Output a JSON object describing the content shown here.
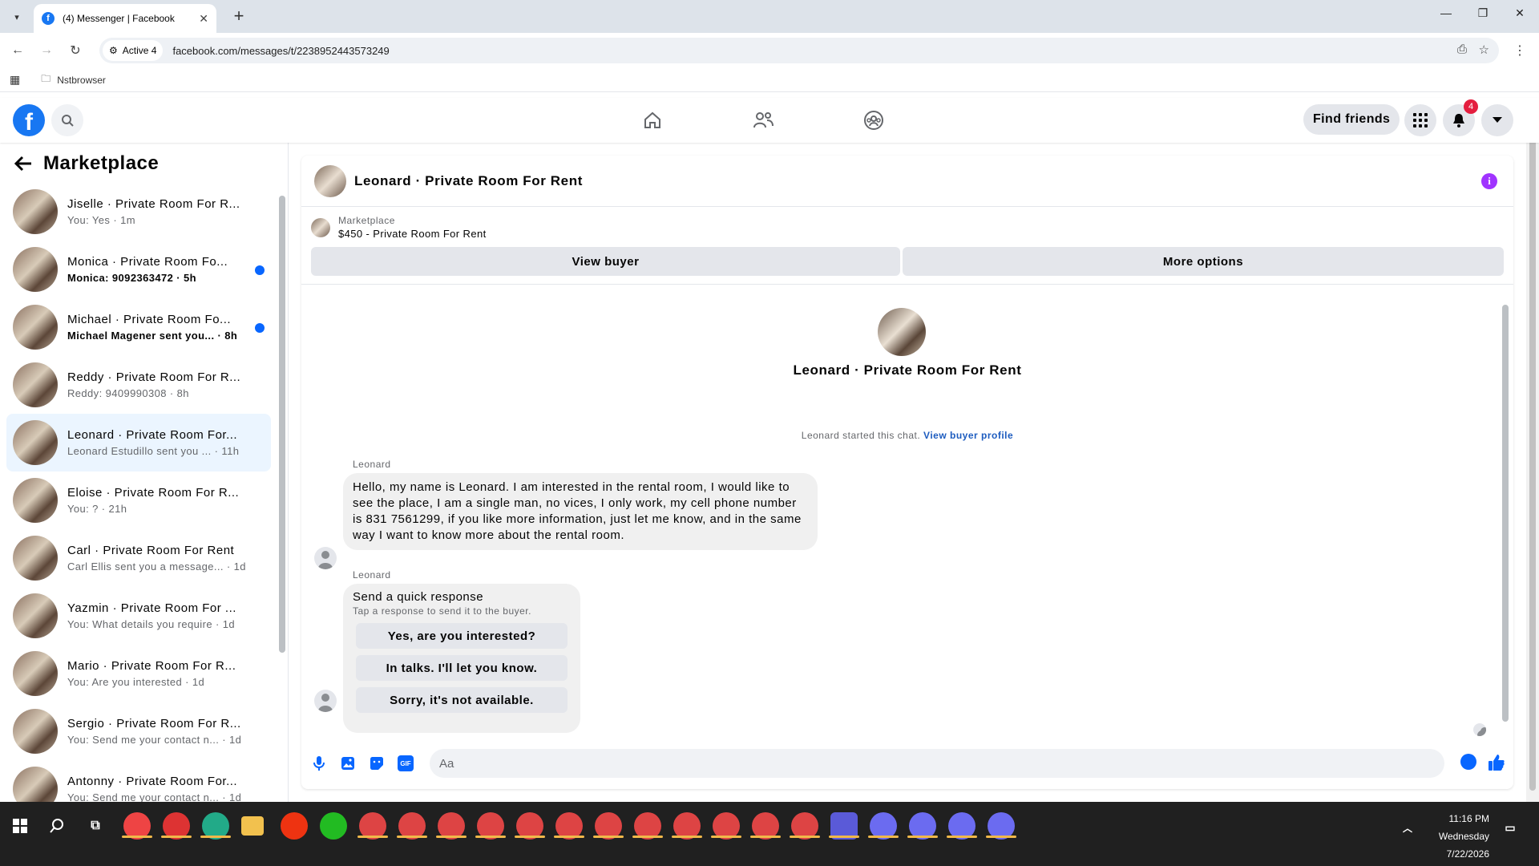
{
  "browser": {
    "tab_title": "(4) Messenger | Facebook",
    "tab_favicon": "f",
    "close_tab": "✕",
    "new_tab": "+",
    "site_info_label": "Active 4",
    "url": "facebook.com/messages/t/2238952443573249",
    "bookmark_folder": "Nstbrowser"
  },
  "fb_header": {
    "find_friends_label": "Find friends",
    "notification_count": "4"
  },
  "sidebar": {
    "title": "Marketplace",
    "conversations": [
      {
        "name": "Jiselle · Private Room For R...",
        "preview": "You: Yes · 1m",
        "unread": false,
        "active": false
      },
      {
        "name": "Monica · Private Room Fo...",
        "preview": "Monica: 9092363472 · 5h",
        "unread": true,
        "active": false
      },
      {
        "name": "Michael · Private Room Fo...",
        "preview": "Michael Magener sent you... · 8h",
        "unread": true,
        "active": false
      },
      {
        "name": "Reddy · Private Room For R...",
        "preview": "Reddy: 9409990308 · 8h",
        "unread": false,
        "active": false
      },
      {
        "name": "Leonard · Private Room For...",
        "preview": "Leonard Estudillo sent you ... · 11h",
        "unread": false,
        "active": true
      },
      {
        "name": "Eloise · Private Room For R...",
        "preview": "You: ? · 21h",
        "unread": false,
        "active": false
      },
      {
        "name": "Carl · Private Room For Rent",
        "preview": "Carl Ellis sent you a message... · 1d",
        "unread": false,
        "active": false
      },
      {
        "name": "Yazmin · Private Room For ...",
        "preview": "You: What details you require · 1d",
        "unread": false,
        "active": false
      },
      {
        "name": "Mario · Private Room For R...",
        "preview": "You: Are you interested · 1d",
        "unread": false,
        "active": false
      },
      {
        "name": "Sergio · Private Room For R...",
        "preview": "You: Send me your contact n... · 1d",
        "unread": false,
        "active": false
      },
      {
        "name": "Antonny · Private Room For...",
        "preview": "You: Send me your contact n... · 1d",
        "unread": false,
        "active": false
      }
    ]
  },
  "chat": {
    "title": "Leonard · Private Room For Rent",
    "info_glyph": "i",
    "marketplace_label": "Marketplace",
    "listing": "$450 - Private Room For Rent",
    "view_buyer_label": "View buyer",
    "more_options_label": "More options",
    "profile_name": "Leonard · Private Room For Rent",
    "started_text": "Leonard started this chat.",
    "view_profile_link": "View buyer profile",
    "message1_sender": "Leonard",
    "message1_text": "Hello, my name is Leonard. I am interested in the rental room, I would like to see the place, I am a single man, no vices, I only work, my cell phone number is 831 7561299, if you like more information, just let me know, and in the same way I want to know more about the rental room.",
    "message2_sender": "Leonard",
    "quick_title": "Send a quick response",
    "quick_subtitle": "Tap a response to send it to the buyer.",
    "quick_options": [
      "Yes, are you interested?",
      "In talks. I'll let you know.",
      "Sorry, it's not available."
    ],
    "composer_placeholder": "Aa",
    "gif_label": "GIF"
  },
  "taskbar": {
    "time": "11:16 PM",
    "day": "Wednesday",
    "date": "7/22/2026"
  },
  "colors": {
    "fb_blue": "#1877f2",
    "messenger_blue": "#0866ff",
    "active_row": "#ebf5ff",
    "info_purple": "#a033ff",
    "badge_red": "#e41e3f"
  },
  "icons": [
    "search-icon",
    "home-icon",
    "friends-icon",
    "groups-icon",
    "menu-grid-icon",
    "bell-icon",
    "caret-down-icon",
    "back-arrow-icon",
    "mic-icon",
    "image-icon",
    "sticker-icon",
    "gif-icon",
    "emoji-icon",
    "like-icon"
  ]
}
